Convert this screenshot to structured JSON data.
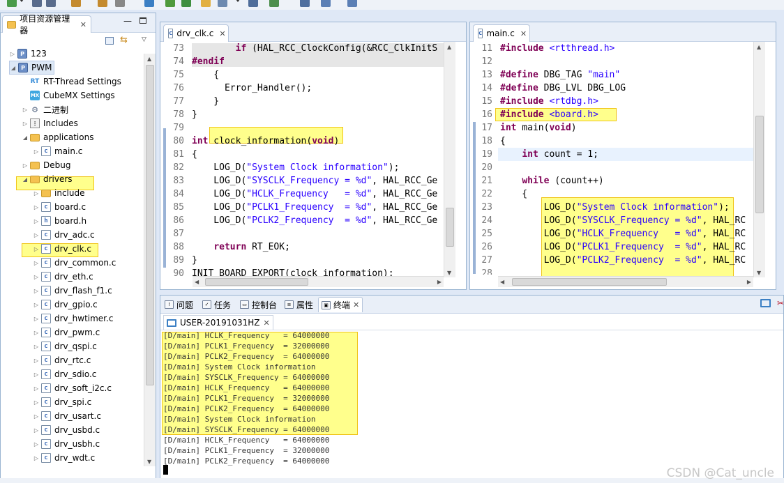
{
  "colors": {
    "highlight": "#ffff8c",
    "highlight_border": "#f0c419",
    "keyword": "#7f0055",
    "string": "#2a00ff",
    "line_number": "#787878"
  },
  "explorer": {
    "tab_title": "项目资源管理器",
    "items": [
      {
        "label": "123",
        "icon": "project-icon",
        "expanded": false
      },
      {
        "label": "PWM",
        "icon": "project-icon",
        "expanded": true,
        "selected": true
      },
      {
        "label": "RT-Thread Settings",
        "icon": "rt-thread-icon"
      },
      {
        "label": "CubeMX Settings",
        "icon": "cubemx-icon"
      },
      {
        "label": "二进制",
        "icon": "binaries-icon"
      },
      {
        "label": "Includes",
        "icon": "includes-icon"
      },
      {
        "label": "applications",
        "icon": "folder-icon",
        "expanded": true
      },
      {
        "label": "main.c",
        "icon": "c-file-icon"
      },
      {
        "label": "Debug",
        "icon": "folder-icon"
      },
      {
        "label": "drivers",
        "icon": "folder-icon",
        "expanded": true,
        "highlighted": true
      },
      {
        "label": "include",
        "icon": "folder-icon"
      },
      {
        "label": "board.c",
        "icon": "c-file-icon"
      },
      {
        "label": "board.h",
        "icon": "h-file-icon"
      },
      {
        "label": "drv_adc.c",
        "icon": "c-file-icon"
      },
      {
        "label": "drv_clk.c",
        "icon": "c-file-icon",
        "highlighted": true
      },
      {
        "label": "drv_common.c",
        "icon": "c-file-icon"
      },
      {
        "label": "drv_eth.c",
        "icon": "c-file-icon"
      },
      {
        "label": "drv_flash_f1.c",
        "icon": "c-file-icon"
      },
      {
        "label": "drv_gpio.c",
        "icon": "c-file-icon"
      },
      {
        "label": "drv_hwtimer.c",
        "icon": "c-file-icon"
      },
      {
        "label": "drv_pwm.c",
        "icon": "c-file-icon"
      },
      {
        "label": "drv_qspi.c",
        "icon": "c-file-icon"
      },
      {
        "label": "drv_rtc.c",
        "icon": "c-file-icon"
      },
      {
        "label": "drv_sdio.c",
        "icon": "c-file-icon"
      },
      {
        "label": "drv_soft_i2c.c",
        "icon": "c-file-icon"
      },
      {
        "label": "drv_spi.c",
        "icon": "c-file-icon"
      },
      {
        "label": "drv_usart.c",
        "icon": "c-file-icon"
      },
      {
        "label": "drv_usbd.c",
        "icon": "c-file-icon"
      },
      {
        "label": "drv_usbh.c",
        "icon": "c-file-icon"
      },
      {
        "label": "drv_wdt.c",
        "icon": "c-file-icon"
      }
    ]
  },
  "editor_left": {
    "tab_title": "drv_clk.c",
    "lines": [
      {
        "n": "73",
        "text": "        if (HAL_RCC_ClockConfig(&RCC_ClkInitS"
      },
      {
        "n": "74",
        "text": "#endif"
      },
      {
        "n": "75",
        "text": "    {"
      },
      {
        "n": "76",
        "text": "      Error_Handler();"
      },
      {
        "n": "77",
        "text": "    }"
      },
      {
        "n": "78",
        "text": "}"
      },
      {
        "n": "79",
        "text": ""
      },
      {
        "n": "80",
        "text": "int clock_information(void)"
      },
      {
        "n": "81",
        "text": "{"
      },
      {
        "n": "82",
        "text": "    LOG_D(\"System Clock information\");"
      },
      {
        "n": "83",
        "text": "    LOG_D(\"SYSCLK_Frequency = %d\", HAL_RCC_Ge"
      },
      {
        "n": "84",
        "text": "    LOG_D(\"HCLK_Frequency   = %d\", HAL_RCC_Ge"
      },
      {
        "n": "85",
        "text": "    LOG_D(\"PCLK1_Frequency  = %d\", HAL_RCC_Ge"
      },
      {
        "n": "86",
        "text": "    LOG_D(\"PCLK2_Frequency  = %d\", HAL_RCC_Ge"
      },
      {
        "n": "87",
        "text": ""
      },
      {
        "n": "88",
        "text": "    return RT_EOK;"
      },
      {
        "n": "89",
        "text": "}"
      },
      {
        "n": "90",
        "text": "INIT_BOARD_EXPORT(clock_information);"
      },
      {
        "n": "91",
        "text": ""
      }
    ]
  },
  "editor_right": {
    "tab_title": "main.c",
    "lines": [
      {
        "n": "11",
        "text": "#include <rtthread.h>"
      },
      {
        "n": "12",
        "text": ""
      },
      {
        "n": "13",
        "text": "#define DBG_TAG \"main\""
      },
      {
        "n": "14",
        "text": "#define DBG_LVL DBG_LOG"
      },
      {
        "n": "15",
        "text": "#include <rtdbg.h>"
      },
      {
        "n": "16",
        "text": "#include <board.h>"
      },
      {
        "n": "17",
        "text": "int main(void)"
      },
      {
        "n": "18",
        "text": "{"
      },
      {
        "n": "19",
        "text": "    int count = 1;"
      },
      {
        "n": "20",
        "text": ""
      },
      {
        "n": "21",
        "text": "    while (count++)"
      },
      {
        "n": "22",
        "text": "    {"
      },
      {
        "n": "23",
        "text": "        LOG_D(\"System Clock information\");"
      },
      {
        "n": "24",
        "text": "        LOG_D(\"SYSCLK_Frequency = %d\", HAL_RC"
      },
      {
        "n": "25",
        "text": "        LOG_D(\"HCLK_Frequency   = %d\", HAL_RC"
      },
      {
        "n": "26",
        "text": "        LOG_D(\"PCLK1_Frequency  = %d\", HAL_RC"
      },
      {
        "n": "27",
        "text": "        LOG_D(\"PCLK2_Frequency  = %d\", HAL_RC"
      },
      {
        "n": "28",
        "text": ""
      }
    ]
  },
  "bottom_panel": {
    "tabs": [
      {
        "label": "问题",
        "icon": "problems-icon"
      },
      {
        "label": "任务",
        "icon": "tasks-icon"
      },
      {
        "label": "控制台",
        "icon": "console-icon"
      },
      {
        "label": "属性",
        "icon": "properties-icon"
      },
      {
        "label": "终端",
        "icon": "terminal-icon",
        "active": true
      }
    ],
    "terminal_tab": "USER-20191031HZ",
    "console_lines": [
      "[D/main] HCLK_Frequency   = 64000000",
      "[D/main] PCLK1_Frequency  = 32000000",
      "[D/main] PCLK2_Frequency  = 64000000",
      "[D/main] System Clock information",
      "[D/main] SYSCLK_Frequency = 64000000",
      "[D/main] HCLK_Frequency   = 64000000",
      "[D/main] PCLK1_Frequency  = 32000000",
      "[D/main] PCLK2_Frequency  = 64000000",
      "[D/main] System Clock information",
      "[D/main] SYSCLK_Frequency = 64000000",
      "[D/main] HCLK_Frequency   = 64000000",
      "[D/main] PCLK1_Frequency  = 32000000",
      "[D/main] PCLK2_Frequency  = 64000000"
    ]
  },
  "watermark": "CSDN @Cat_uncle"
}
